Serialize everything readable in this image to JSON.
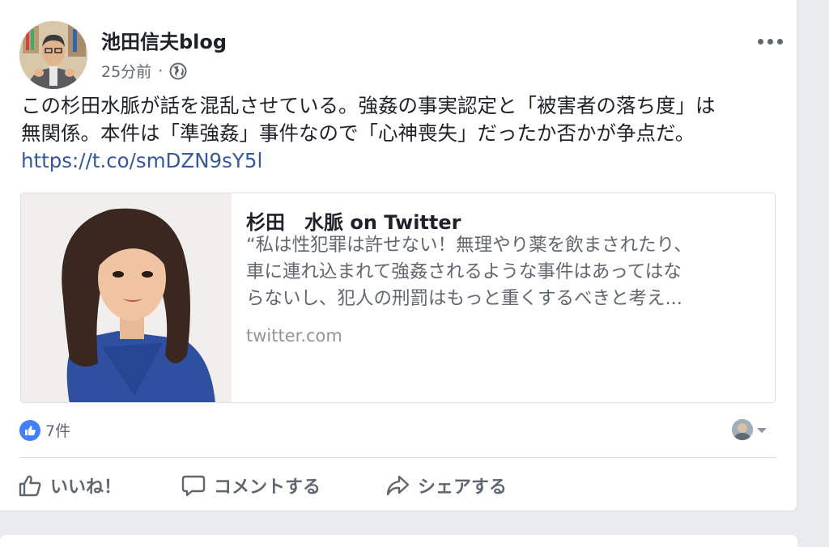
{
  "post": {
    "author": "池田信夫blog",
    "timestamp": "25分前",
    "separator": "·",
    "audience_icon": "globe-icon",
    "text_lines": [
      "この杉田水脈が話を混乱させている。強姦の事実認定と「被害者の落ち度」は",
      "無関係。本件は「準強姦」事件なので「心神喪失」だったか否かが争点だ。"
    ],
    "link_text": "https://t.co/smDZN9sY5l",
    "more_icon": "more-horizontal-icon"
  },
  "link_preview": {
    "title": "杉田　水脈 on Twitter",
    "description_lines": [
      "“私は性犯罪は許せない！無理やり薬を飲まされたり、",
      "車に連れ込まれて強姦されるような事件はあってはな",
      "らないし、犯人の刑罰はもっと重くするべきと考え..."
    ],
    "domain": "twitter.com"
  },
  "reactions": {
    "count_label": "7件",
    "icon": "thumbs-up-icon"
  },
  "actions": {
    "like": "いいね！",
    "comment": "コメントする",
    "share": "シェアする"
  },
  "colors": {
    "link": "#365899",
    "like_badge": "#4080ff",
    "background": "#e9ebee"
  }
}
